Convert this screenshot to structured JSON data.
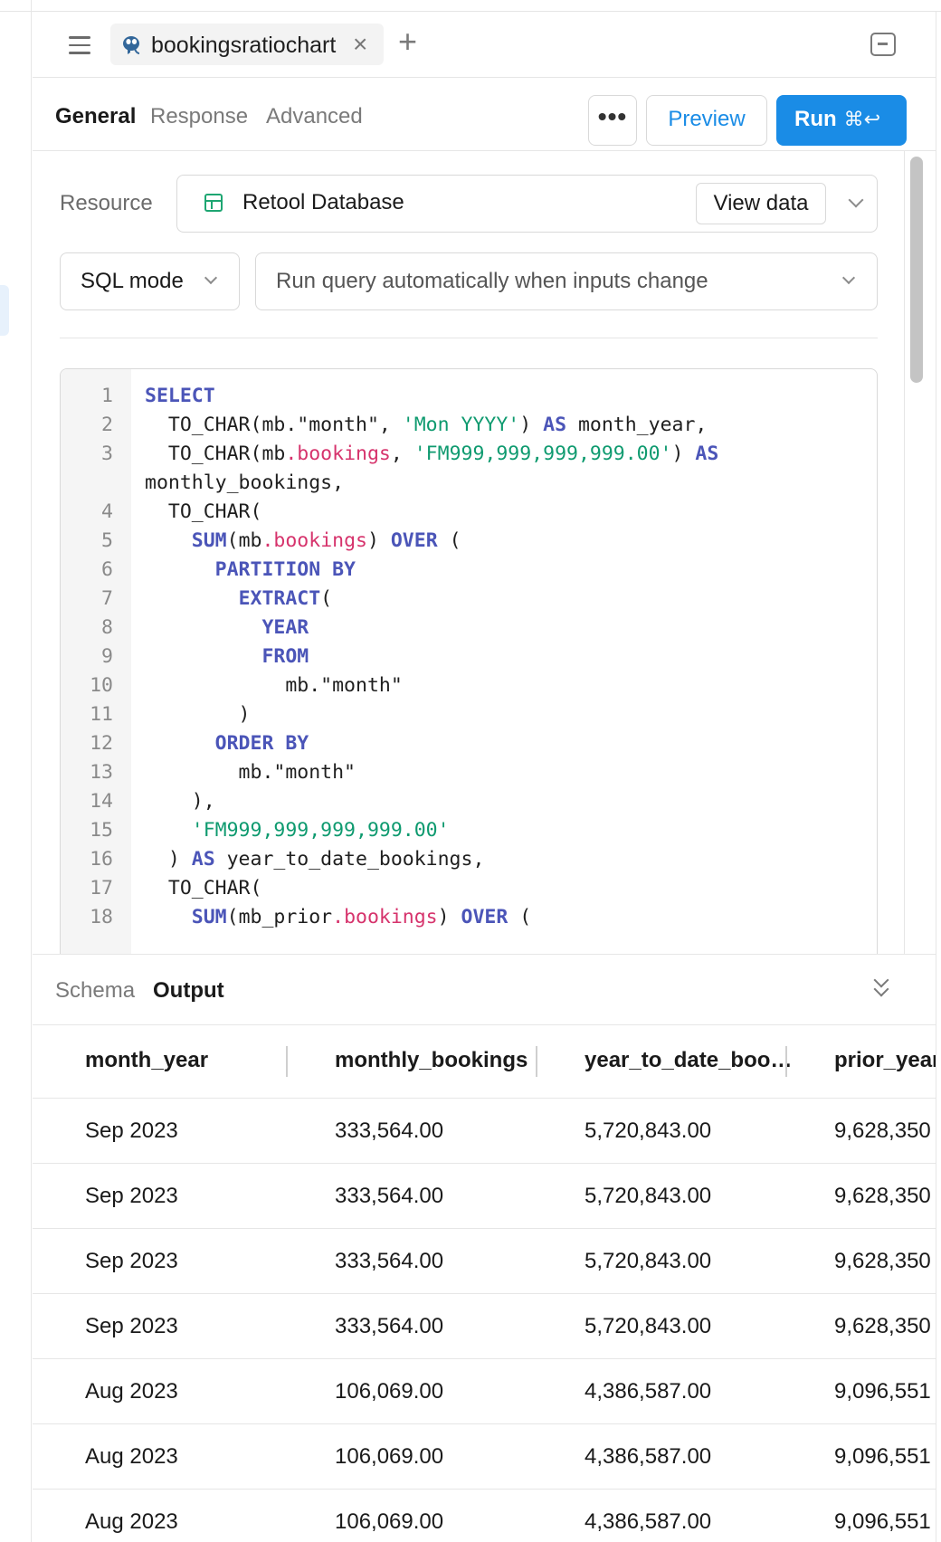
{
  "tabs": {
    "query_name": "bookingsratiochart"
  },
  "subtabs": [
    "General",
    "Response",
    "Advanced"
  ],
  "toolbar": {
    "more": "•••",
    "preview": "Preview",
    "run": "Run",
    "run_shortcut": "⌘↩"
  },
  "resource": {
    "label": "Resource",
    "value": "Retool Database",
    "view_data": "View data"
  },
  "mode": {
    "value": "SQL mode"
  },
  "trigger": {
    "value": "Run query automatically when inputs change"
  },
  "code_lines": [
    {
      "n": "1",
      "html": "<span class=\"kw\">SELECT</span>"
    },
    {
      "n": "2",
      "html": "  TO_CHAR(mb.\"month\", <span class=\"st\">'Mon YYYY'</span>) <span class=\"kw\">AS</span> month_year,"
    },
    {
      "n": "3",
      "html": "  TO_CHAR(mb<span class=\"pr\">.bookings</span>, <span class=\"st\">'FM999,999,999,999.00'</span>) <span class=\"kw\">AS</span>"
    },
    {
      "n": "",
      "html": "monthly_bookings,"
    },
    {
      "n": "4",
      "html": "  TO_CHAR("
    },
    {
      "n": "5",
      "html": "    <span class=\"kw\">SUM</span>(mb<span class=\"pr\">.bookings</span>) <span class=\"kw\">OVER</span> ("
    },
    {
      "n": "6",
      "html": "      <span class=\"kw\">PARTITION BY</span>"
    },
    {
      "n": "7",
      "html": "        <span class=\"kw\">EXTRACT</span>("
    },
    {
      "n": "8",
      "html": "          <span class=\"kw\">YEAR</span>"
    },
    {
      "n": "9",
      "html": "          <span class=\"kw\">FROM</span>"
    },
    {
      "n": "10",
      "html": "            mb.\"month\""
    },
    {
      "n": "11",
      "html": "        )"
    },
    {
      "n": "12",
      "html": "      <span class=\"kw\">ORDER BY</span>"
    },
    {
      "n": "13",
      "html": "        mb.\"month\""
    },
    {
      "n": "14",
      "html": "    ),"
    },
    {
      "n": "15",
      "html": "    <span class=\"st\">'FM999,999,999,999.00'</span>"
    },
    {
      "n": "16",
      "html": "  ) <span class=\"kw\">AS</span> year_to_date_bookings,"
    },
    {
      "n": "17",
      "html": "  TO_CHAR("
    },
    {
      "n": "18",
      "html": "    <span class=\"kw\">SUM</span>(mb_prior<span class=\"pr\">.bookings</span>) <span class=\"kw\">OVER</span> ("
    }
  ],
  "results_tabs": [
    "Schema",
    "Output"
  ],
  "table": {
    "columns": [
      "month_year",
      "monthly_bookings",
      "year_to_date_boo…",
      "prior_year"
    ],
    "rows": [
      [
        "Sep 2023",
        "333,564.00",
        "5,720,843.00",
        "9,628,350"
      ],
      [
        "Sep 2023",
        "333,564.00",
        "5,720,843.00",
        "9,628,350"
      ],
      [
        "Sep 2023",
        "333,564.00",
        "5,720,843.00",
        "9,628,350"
      ],
      [
        "Sep 2023",
        "333,564.00",
        "5,720,843.00",
        "9,628,350"
      ],
      [
        "Aug 2023",
        "106,069.00",
        "4,386,587.00",
        "9,096,551"
      ],
      [
        "Aug 2023",
        "106,069.00",
        "4,386,587.00",
        "9,096,551"
      ],
      [
        "Aug 2023",
        "106,069.00",
        "4,386,587.00",
        "9,096,551"
      ]
    ]
  },
  "icons": {
    "hamburger": "menu-icon",
    "db": "postgres-icon",
    "close": "close-icon",
    "add": "plus-icon",
    "collapse": "collapse-panel-icon",
    "table": "table-icon",
    "chevron": "chevron-down-icon",
    "double_chevron": "double-chevron-down-icon"
  },
  "colors": {
    "accent": "#1a8ce6",
    "keyword": "#4b55b8",
    "string": "#0e9a6f",
    "property": "#d6336c",
    "db_green": "#1ea672"
  }
}
